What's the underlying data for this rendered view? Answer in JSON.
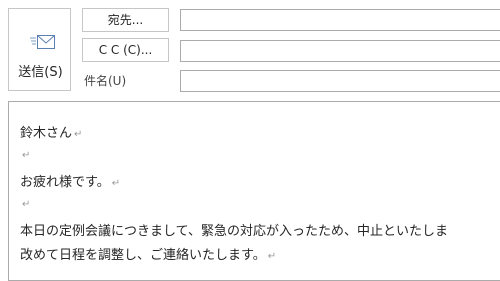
{
  "toolbar": {
    "send_label": "送信(S)",
    "to_label": "宛先...",
    "cc_label": "C C (C)...",
    "subject_label": "件名(U)"
  },
  "fields": {
    "to_value": "",
    "cc_value": "",
    "subject_value": ""
  },
  "body": {
    "paragraph_mark": "↵",
    "lines": [
      "鈴木さん",
      "",
      "お疲れ様です。",
      "",
      "本日の定例会議につきまして、緊急の対応が入ったため、中止といたしま",
      "改めて日程を調整し、ご連絡いたします。"
    ]
  },
  "colors": {
    "border": "#c6c6c6",
    "field_border": "#ababab",
    "text": "#262626",
    "paragraph_mark": "#999999"
  },
  "icons": {
    "send": "envelope-send-icon"
  }
}
